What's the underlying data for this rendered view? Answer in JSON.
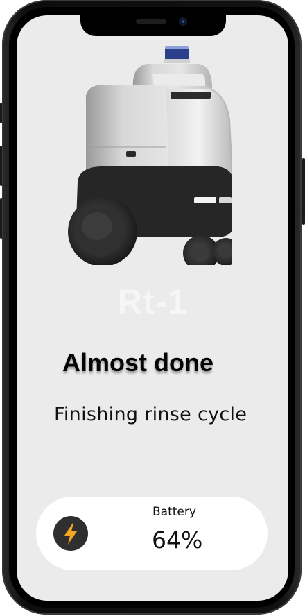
{
  "robot": {
    "name": "Rt-1",
    "image": "delivery-robot-illustration"
  },
  "status": {
    "title": "Almost done",
    "subtitle": "Finishing rinse cycle"
  },
  "battery": {
    "label": "Battery",
    "value": "64%",
    "level_percent": 64,
    "icon": "lightning-bolt-icon",
    "icon_color": "#f5a623"
  },
  "colors": {
    "screen_background": "#ebebeb",
    "card_background": "#ffffff",
    "bolt_circle": "#2f2f2f"
  }
}
